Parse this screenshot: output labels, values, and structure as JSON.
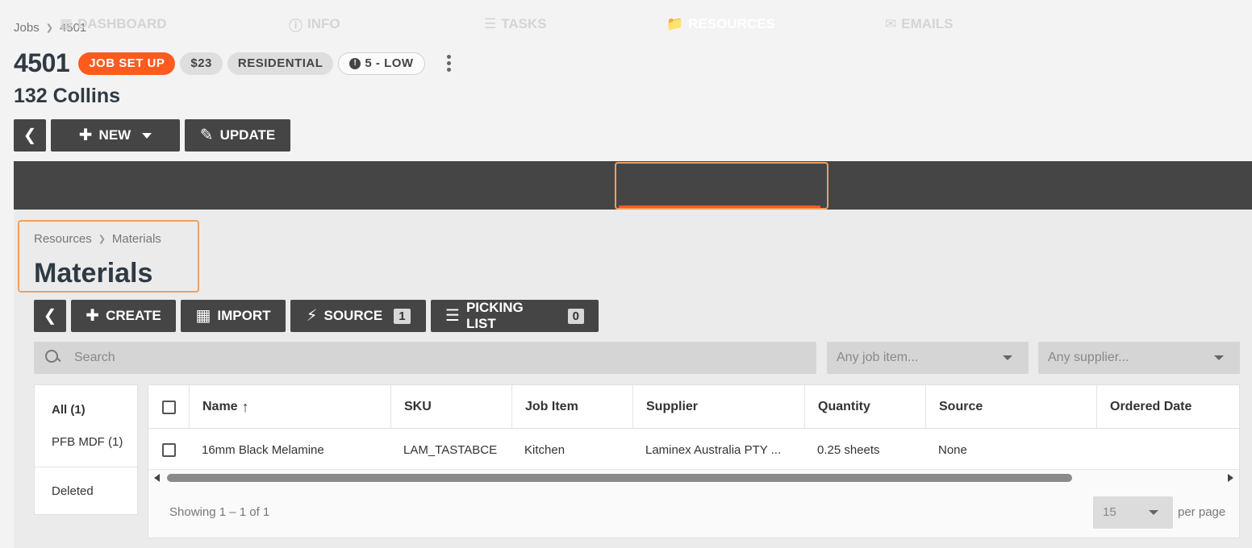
{
  "breadcrumb": {
    "root": "Jobs",
    "current": "4501"
  },
  "job": {
    "number": "4501",
    "status": "JOB SET UP",
    "amount": "$23",
    "type": "RESIDENTIAL",
    "priority": "5 - LOW",
    "address": "132 Collins"
  },
  "toolbar": {
    "new_label": "NEW",
    "update_label": "UPDATE"
  },
  "tabs": {
    "dashboard": "DASHBOARD",
    "info": "INFO",
    "tasks": "TASKS",
    "resources": "RESOURCES",
    "emails": "EMAILS",
    "active": "RESOURCES"
  },
  "sub_breadcrumb": {
    "root": "Resources",
    "current": "Materials"
  },
  "page_title": "Materials",
  "actions": {
    "create": "CREATE",
    "import": "IMPORT",
    "source": "SOURCE",
    "source_count": "1",
    "picking_list": "PICKING LIST",
    "picking_count": "0"
  },
  "search": {
    "placeholder": "Search"
  },
  "filters_dd": {
    "job_item": "Any job item...",
    "supplier": "Any supplier..."
  },
  "side_filters": {
    "all": "All (1)",
    "pfb": "PFB MDF (1)",
    "deleted": "Deleted"
  },
  "table": {
    "headers": {
      "name": "Name",
      "sku": "SKU",
      "job_item": "Job Item",
      "supplier": "Supplier",
      "quantity": "Quantity",
      "source": "Source",
      "ordered_date": "Ordered Date"
    },
    "rows": [
      {
        "name": "16mm Black Melamine",
        "sku": "LAM_TASTABCE",
        "job_item": "Kitchen",
        "supplier": "Laminex Australia PTY ...",
        "quantity": "0.25 sheets",
        "source": "None",
        "ordered_date": ""
      }
    ]
  },
  "pagination": {
    "showing": "Showing 1 – 1 of 1",
    "per_page_value": "15",
    "per_page_label": "per page"
  },
  "colors": {
    "accent": "#ff5a1f",
    "dark": "#454545",
    "highlight": "#f0a060"
  }
}
